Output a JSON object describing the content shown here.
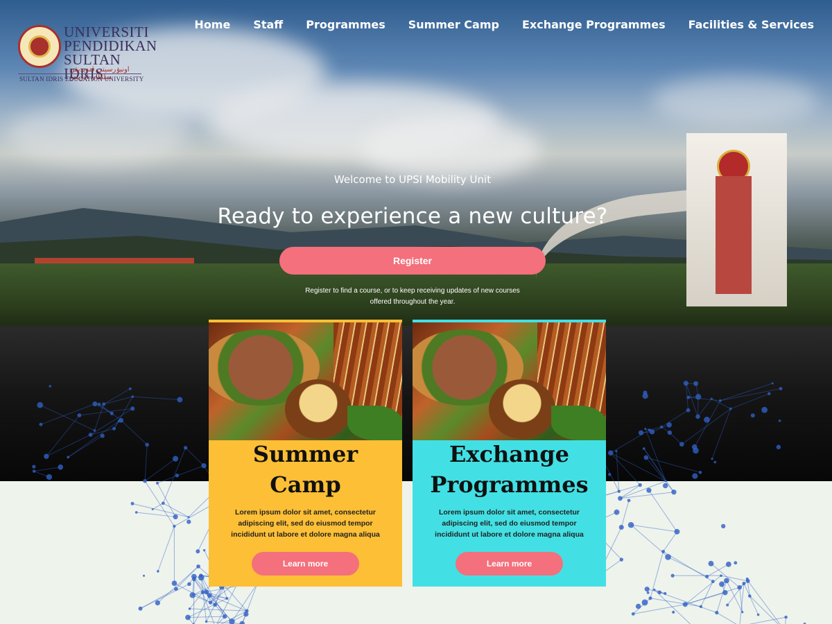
{
  "logo": {
    "name_lines": [
      "UNIVERSITI",
      "PENDIDIKAN",
      "SULTAN IDRIS"
    ],
    "arabic": "اونيۏرسيتي ڤنديديقن سلطان ادريس",
    "sub": "SULTAN IDRIS EDUCATION UNIVERSITY"
  },
  "nav": {
    "items": [
      "Home",
      "Staff",
      "Programmes",
      "Summer Camp",
      "Exchange Programmes",
      "Facilities & Services"
    ]
  },
  "hero": {
    "welcome": "Welcome to UPSI Mobility Unit",
    "headline": "Ready to experience a new culture?",
    "register_label": "Register",
    "note_line1": "Register to find a course, or to keep receiving updates of new courses",
    "note_line2": "offered throughout the year."
  },
  "cards": [
    {
      "title_line1": "Summer",
      "title_line2": "Camp",
      "body_line1": "Lorem ipsum dolor sit amet, consectetur",
      "body_line2": "adipiscing elit, sed do eiusmod tempor",
      "body_line3": "incididunt ut labore et dolore magna aliqua",
      "button": "Learn more",
      "color": "#fdbf35"
    },
    {
      "title_line1": "Exchange",
      "title_line2": "Programmes",
      "body_line1": "Lorem ipsum dolor sit amet, consectetur",
      "body_line2": "adipiscing elit, sed do eiusmod tempor",
      "body_line3": "incididunt ut labore et dolore magna aliqua",
      "button": "Learn more",
      "color": "#42e0e4"
    }
  ],
  "colors": {
    "accent_button": "#f3707c",
    "page_background": "#eef3ec",
    "network_dots": "#2f5fc4"
  }
}
